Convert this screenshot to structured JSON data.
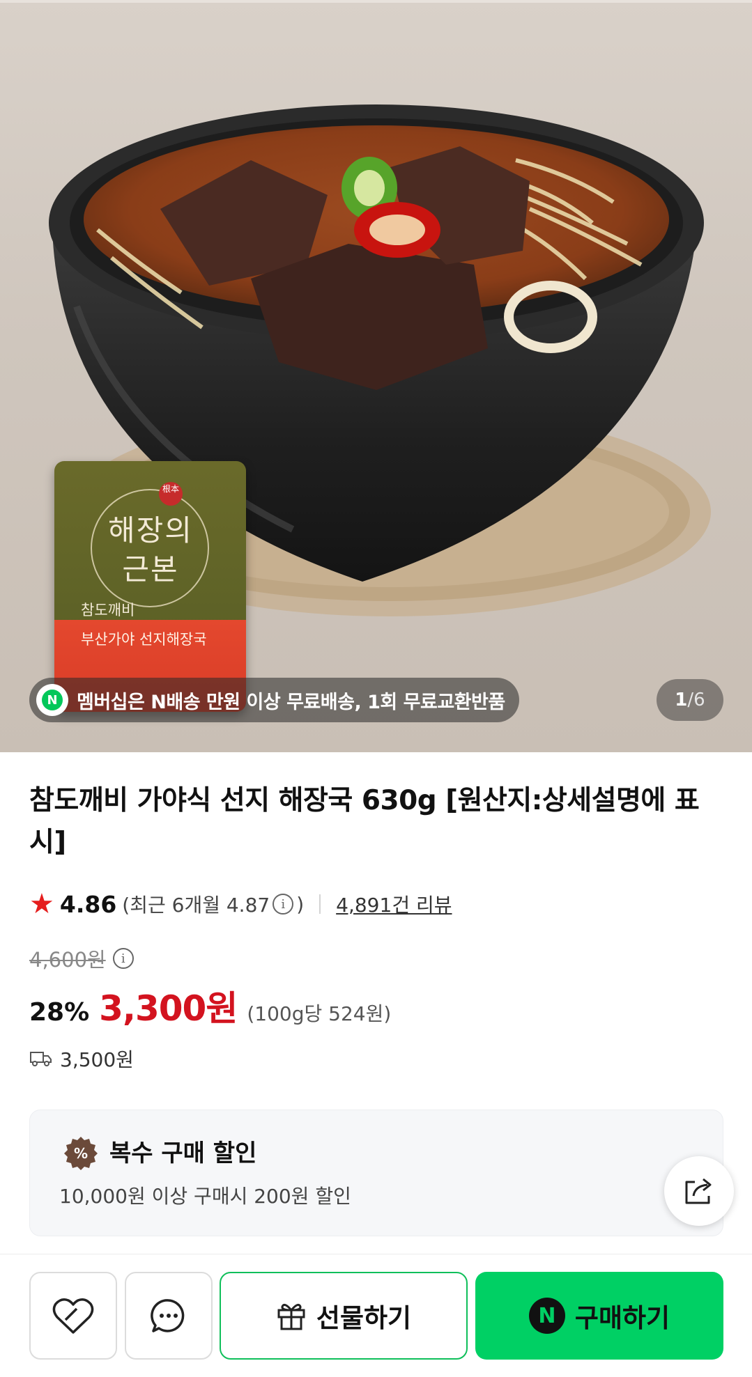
{
  "hero": {
    "pouch": {
      "seal_text": "根本",
      "brand_line1": "해장의",
      "brand_line2": "근본",
      "subtitle": "참도깨비",
      "product_name": "부산가야 선지해장국"
    },
    "promo_badge_letter": "N",
    "promo_text": "멤버십은 N배송 만원 이상 무료배송, 1회 무료교환반품",
    "counter": {
      "current": "1",
      "separator": " / ",
      "total": "6"
    }
  },
  "product": {
    "title": "참도깨비 가야식 선지 해장국 630g [원산지:상세설명에 표시]",
    "rating": {
      "star": "★",
      "score": "4.86",
      "recent_prefix": "(최근 6개월 4.87",
      "recent_suffix": ")",
      "info_glyph": "i",
      "review_count": "4,891건 리뷰"
    },
    "original_price": "4,600원",
    "discount_rate": "28%",
    "sale_price": "3,300원",
    "unit_price": "(100g당 524원)",
    "shipping_fee": "3,500원"
  },
  "coupon": {
    "icon_text": "%",
    "title": "복수 구매 할인",
    "description": "10,000원 이상 구매시 200원 할인"
  },
  "bottom_bar": {
    "gift_label": "선물하기",
    "buy_badge": "N",
    "buy_label": "구매하기"
  },
  "colors": {
    "sale_red": "#d3131f",
    "naver_green": "#00d064",
    "star_red": "#e51e1e"
  },
  "icons": [
    "n-delivery-icon",
    "info-icon",
    "truck-icon",
    "discount-percent-icon",
    "share-icon",
    "heart-icon",
    "chat-icon",
    "gift-icon",
    "naver-pay-icon"
  ]
}
